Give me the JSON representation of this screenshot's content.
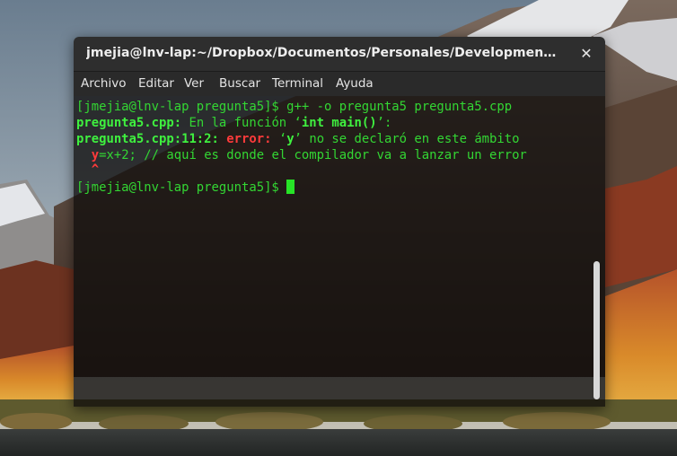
{
  "window": {
    "title": "jmejia@lnv-lap:~/Dropbox/Documentos/Personales/Development/programm...",
    "close_icon": "close-icon"
  },
  "menu": [
    "Archivo",
    "Editar",
    "Ver",
    "Buscar",
    "Terminal",
    "Ayuda"
  ],
  "terminal": {
    "line1": {
      "prompt": "[jmejia@lnv-lap pregunta5]$",
      "command": " g++ -o pregunta5 pregunta5.cpp"
    },
    "line2": {
      "file": "pregunta5.cpp:",
      "text_a": " En la función ",
      "quote_open": "‘",
      "code": "int main()",
      "quote_close": "’",
      "text_b": ":"
    },
    "line3": {
      "location": "pregunta5.cpp:11:2:",
      "error_label": "error:",
      "space": " ",
      "quote_open": "‘",
      "ident": "y",
      "quote_close": "’",
      "message": " no se declaró en este ámbito"
    },
    "line4": {
      "indent": "  ",
      "highlight": "y",
      "rest": "=x+2; // aquí es donde el compilador va a lanzar un error"
    },
    "line5": {
      "indent": "  ",
      "caret": "^"
    },
    "line6": {
      "prompt": "[jmejia@lnv-lap pregunta5]$",
      "trailing": " "
    }
  },
  "colors": {
    "prompt_green": "#33d633",
    "error_red": "#ff3b3b"
  }
}
